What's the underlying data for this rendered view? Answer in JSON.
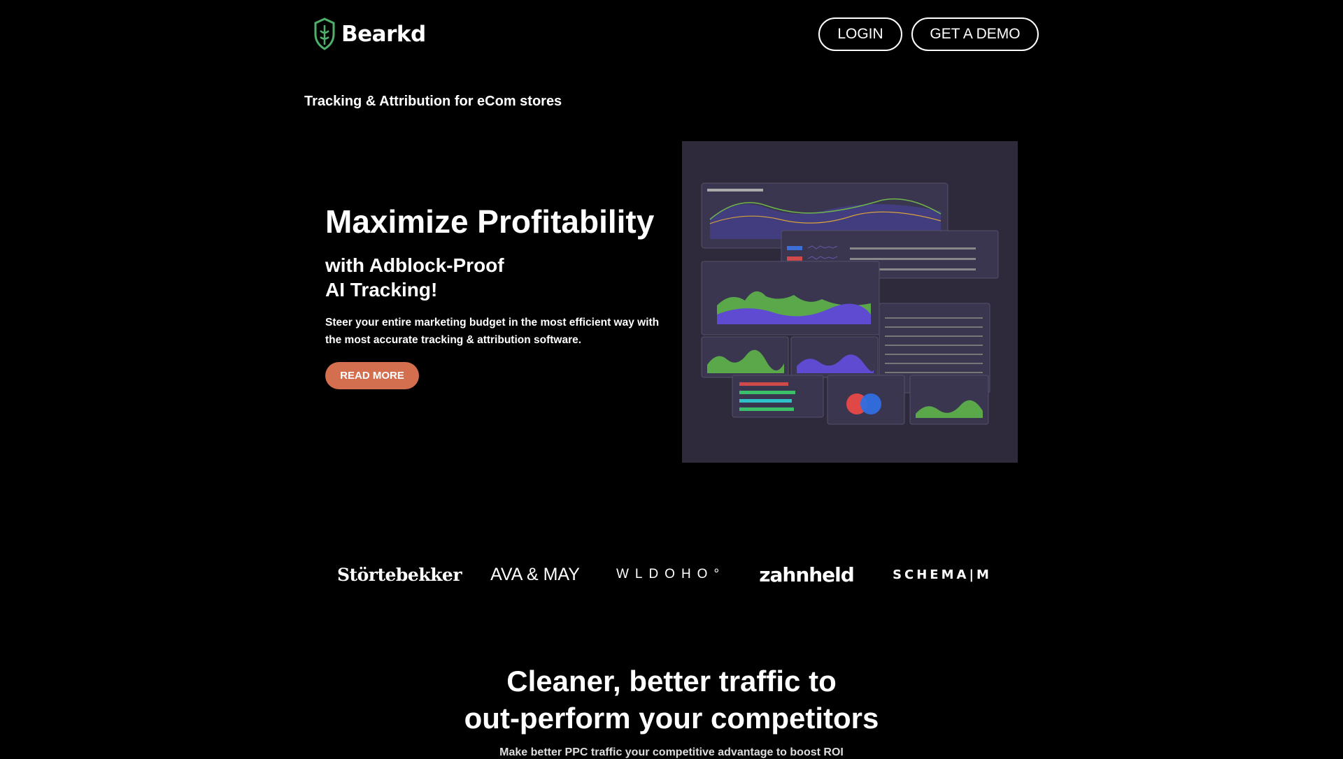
{
  "header": {
    "brand": "Bearkd",
    "login_label": "LOGIN",
    "demo_label": "GET A DEMO"
  },
  "tagline": "Tracking & Attribution for eCom stores",
  "hero": {
    "title": "Maximize Profitability",
    "subtitle_line1": "with Adblock-Proof",
    "subtitle_line2": "AI Tracking!",
    "description": "Steer your entire marketing budget in the most efficient way with the most accurate tracking & attribution software.",
    "cta_label": "READ MORE",
    "cta_color": "#d36e4e"
  },
  "client_logos": [
    "Störtebekker",
    "AVA & MAY",
    "WLDOHO°",
    "zahnheld",
    "SCHEMA|M"
  ],
  "section2": {
    "title_line1": "Cleaner, better traffic to",
    "title_line2": "out-perform your competitors",
    "subtitle": "Make better PPC traffic your competitive advantage to boost ROI"
  },
  "colors": {
    "background": "#000000",
    "accent_green": "#4fb06b",
    "dashboard_bg": "#2e2a3c"
  }
}
